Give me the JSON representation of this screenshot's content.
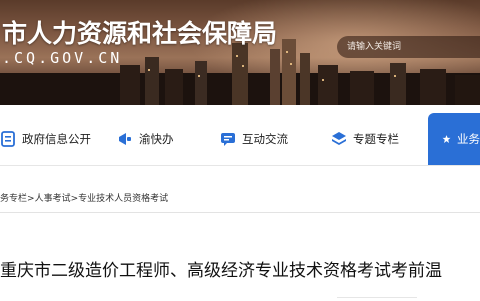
{
  "header": {
    "title": "市人力资源和社会保障局",
    "domain": ".CQ.GOV.CN",
    "search": {
      "placeholder": "请输入关键词"
    }
  },
  "nav": {
    "items": [
      {
        "label": "政府信息公开",
        "icon": "document-list-icon"
      },
      {
        "label": "渝快办",
        "icon": "megaphone-icon"
      },
      {
        "label": "互动交流",
        "icon": "chat-icon"
      },
      {
        "label": "专题专栏",
        "icon": "layers-icon"
      },
      {
        "label": "业务",
        "icon": "star-icon"
      }
    ],
    "active_color": "#2a6fd6",
    "icon_color": "#2a6fd6"
  },
  "breadcrumb": {
    "items": [
      "务专栏",
      "人事考试",
      "专业技术人员资格考试"
    ],
    "separator": ">"
  },
  "article": {
    "title": "重庆市二级造价工程师、高级经济专业技术资格考试考前温"
  }
}
